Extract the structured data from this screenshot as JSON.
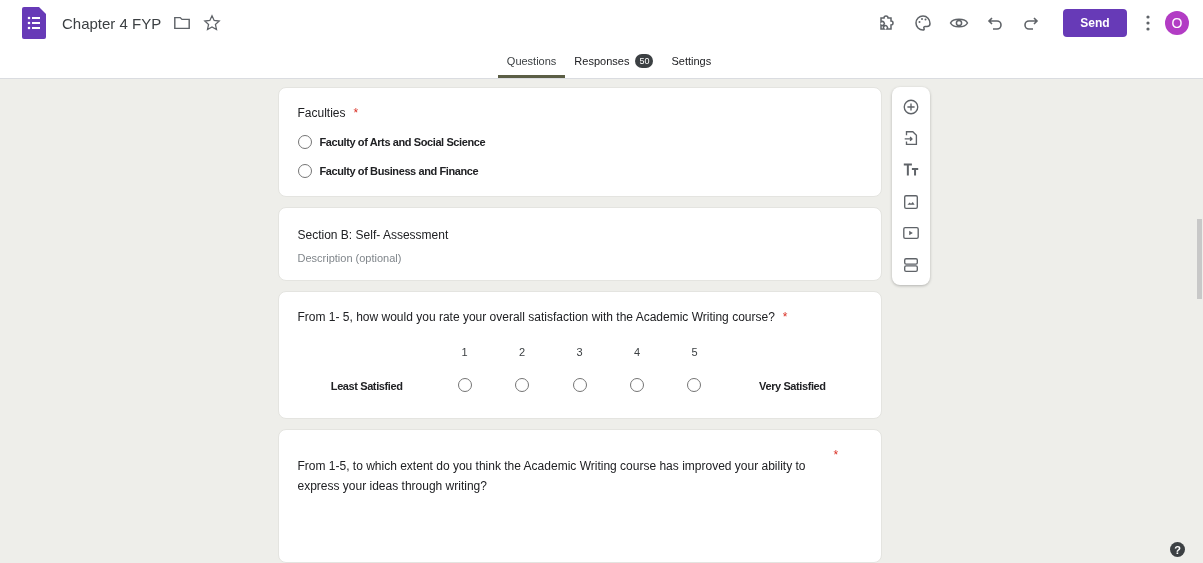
{
  "header": {
    "title": "Chapter 4 FYP",
    "send_label": "Send",
    "avatar_letter": "O"
  },
  "tabs": [
    {
      "label": "Questions",
      "selected": true
    },
    {
      "label": "Responses",
      "selected": false,
      "badge": "50"
    },
    {
      "label": "Settings",
      "selected": false
    }
  ],
  "cards": [
    {
      "kind": "choice",
      "title": "Faculties",
      "required_mark": "*",
      "options": [
        {
          "label": "Faculty of Arts and Social Science",
          "selected": false
        },
        {
          "label": "Faculty of Business and Finance",
          "selected": false
        }
      ]
    },
    {
      "kind": "section",
      "title": "Section B: Self- Assessment",
      "placeholder": "Description (optional)"
    },
    {
      "kind": "scale",
      "title": "From 1- 5, how would you rate your overall satisfaction with the Academic Writing course?",
      "required_mark": "*",
      "low_label": "Least Satisfied",
      "high_label": "Very Satisfied",
      "points": [
        {
          "label": "1",
          "selected": false
        },
        {
          "label": "2",
          "selected": false
        },
        {
          "label": "3",
          "selected": false
        },
        {
          "label": "4",
          "selected": false
        },
        {
          "label": "5",
          "selected": false
        }
      ]
    },
    {
      "kind": "question",
      "title": "From 1-5, to which extent do you think the Academic Writing course has improved your ability to express your ideas through writing?",
      "required_mark": "*"
    }
  ],
  "help_mark": "?"
}
